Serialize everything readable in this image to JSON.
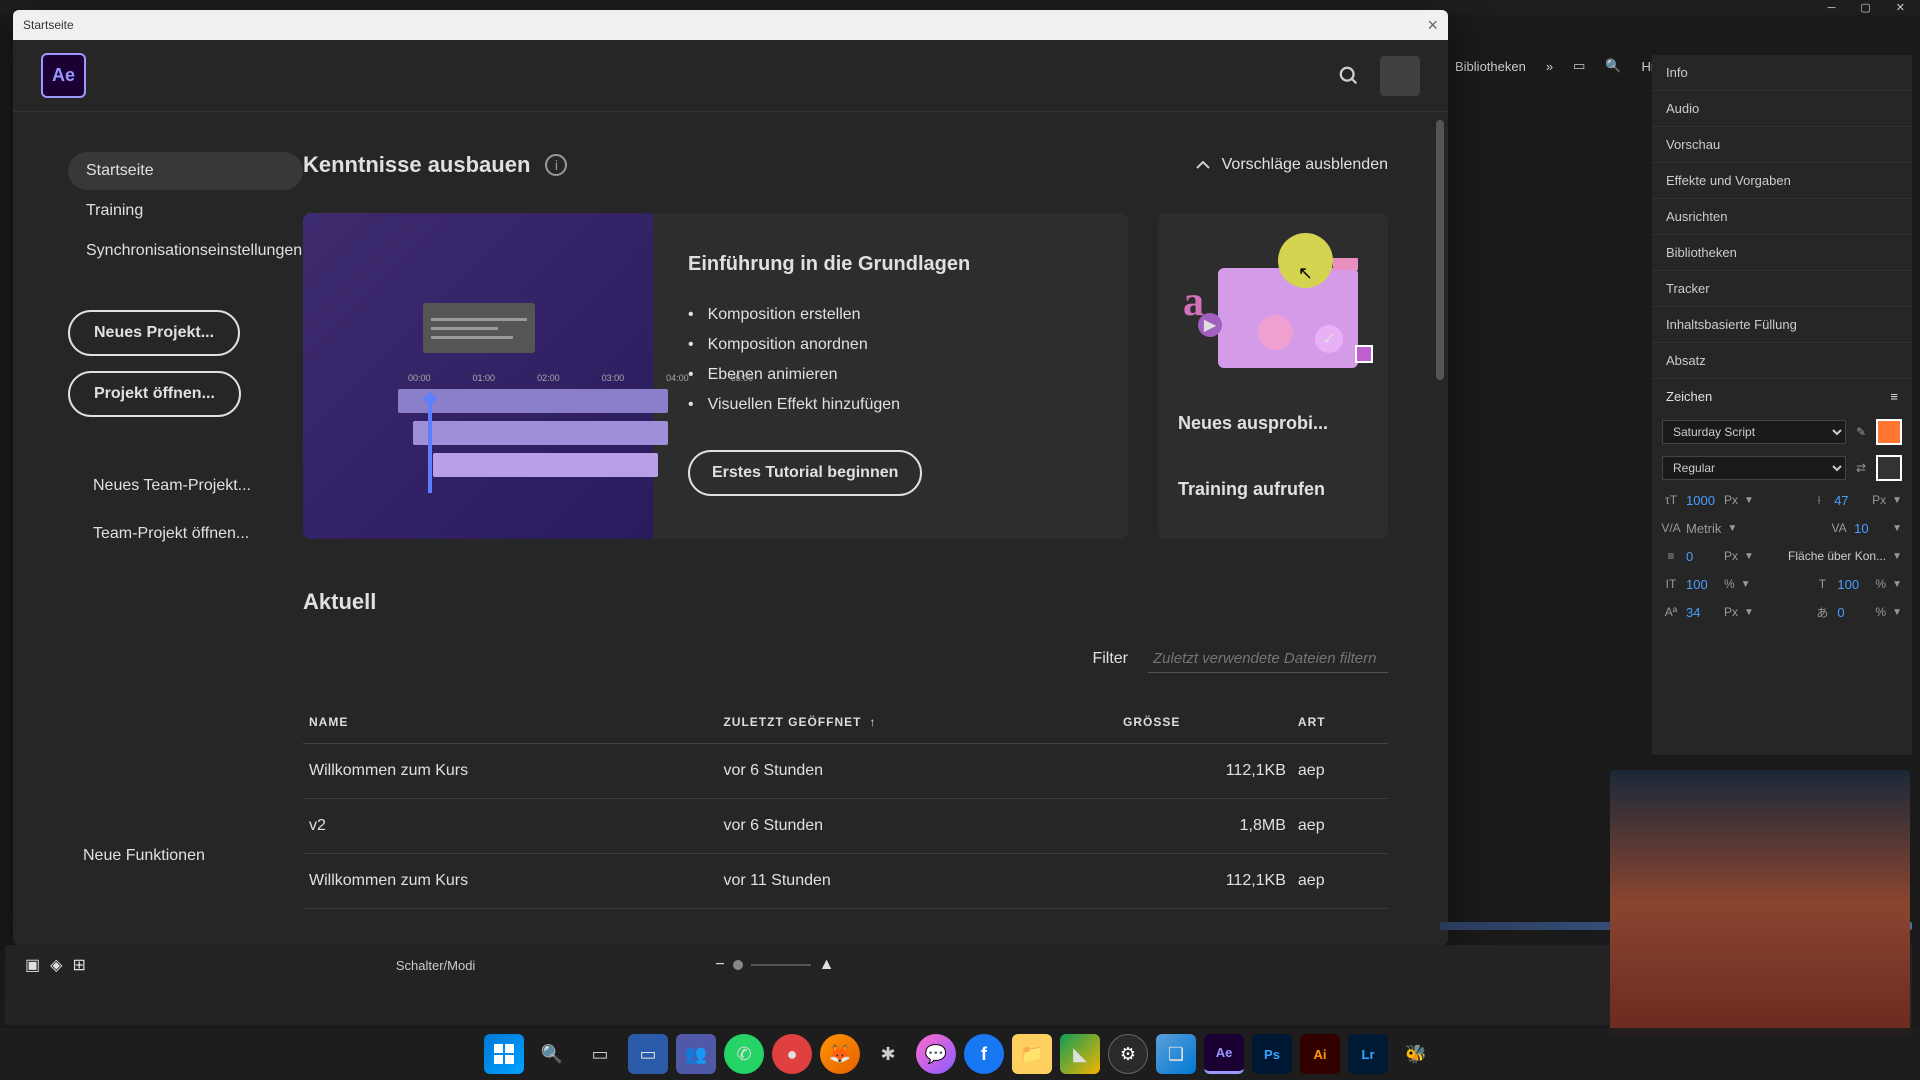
{
  "window": {
    "title": "Startseite",
    "min": "─",
    "max": "▢",
    "close": "✕"
  },
  "logo": "Ae",
  "sidebar": {
    "nav": [
      {
        "label": "Startseite",
        "active": true
      },
      {
        "label": "Training",
        "active": false
      },
      {
        "label": "Synchronisationseinstellungen",
        "active": false
      }
    ],
    "actions": {
      "new_project": "Neues Projekt...",
      "open_project": "Projekt öffnen..."
    },
    "team": {
      "new": "Neues Team-Projekt...",
      "open": "Team-Projekt öffnen..."
    },
    "new_features": "Neue Funktionen"
  },
  "header": "Startseite",
  "skills": {
    "title": "Kenntnisse ausbauen",
    "toggle": "Vorschläge ausblenden"
  },
  "intro_card": {
    "title": "Einführung in die Grundlagen",
    "items": [
      "Komposition erstellen",
      "Komposition anordnen",
      "Ebenen animieren",
      "Visuellen Effekt hinzufügen"
    ],
    "button": "Erstes Tutorial beginnen",
    "ruler": [
      "00:00",
      "01:00",
      "02:00",
      "03:00",
      "04:00",
      "05:00"
    ]
  },
  "small_card": {
    "title": "Neues ausprobi...",
    "link": "Training aufrufen"
  },
  "recent": {
    "title": "Aktuell",
    "filter_label": "Filter",
    "filter_placeholder": "Zuletzt verwendete Dateien filtern",
    "cols": {
      "name": "NAME",
      "opened": "ZULETZT GEÖFFNET",
      "size": "GRÖSSE",
      "type": "ART"
    },
    "rows": [
      {
        "name": "Willkommen zum Kurs",
        "opened": "vor 6 Stunden",
        "size": "112,1KB",
        "type": "aep"
      },
      {
        "name": "v2",
        "opened": "vor 6 Stunden",
        "size": "1,8MB",
        "type": "aep"
      },
      {
        "name": "Willkommen zum Kurs",
        "opened": "vor 11 Stunden",
        "size": "112,1KB",
        "type": "aep"
      }
    ]
  },
  "panels": {
    "biblio": "Bibliotheken",
    "help": "Hilfe durchsuchen",
    "list": [
      "Info",
      "Audio",
      "Vorschau",
      "Effekte und Vorgaben",
      "Ausrichten",
      "Bibliotheken",
      "Tracker",
      "Inhaltsbasierte Füllung",
      "Absatz"
    ],
    "zeichen": "Zeichen"
  },
  "char": {
    "font": "Saturday Script",
    "style": "Regular",
    "size": "1000",
    "size_u": "Px",
    "leading": "47",
    "leading_u": "Px",
    "kerning": "Metrik",
    "tracking": "10",
    "stroke": "0",
    "stroke_u": "Px",
    "stroke_over": "Fläche über Kon...",
    "scale_v": "100",
    "scale_h": "100",
    "pct": "%",
    "baseline": "34",
    "baseline_u": "Px",
    "tsume": "0",
    "tsume_u": "%"
  },
  "bottom": {
    "label": "Schalter/Modi"
  }
}
